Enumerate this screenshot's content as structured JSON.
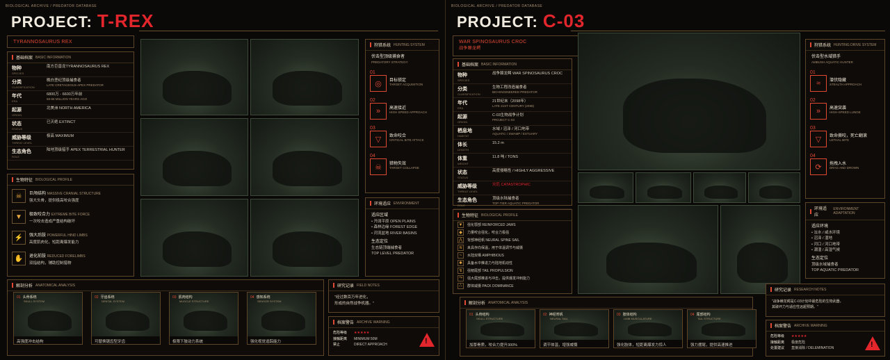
{
  "left": {
    "crumb": "BIOLOGICAL ARCHIVE  /  PREDATOR DATABASE",
    "title_prefix": "PROJECT:",
    "title_code": "T-REX",
    "subtitle": "TYRANNOSAURUS REX",
    "basic": {
      "zh": "基础档案",
      "en": "BASIC INFORMATION",
      "rows": [
        {
          "k": "物种",
          "ken": "SPECIES",
          "v": "南方巨兽龙TYRANNOSAURUS REX",
          "v2": ""
        },
        {
          "k": "分类",
          "ken": "CLASSIFICATION",
          "v": "晚白垩纪顶级捕食者",
          "v2": "LATE CRETACEOUS APEX PREDATOR"
        },
        {
          "k": "年代",
          "ken": "ERA",
          "v": "6800万 - 6600万年前",
          "v2": "68-66 MILLION YEARS AGO"
        },
        {
          "k": "起源",
          "ken": "ORIGIN",
          "v": "北美洲   NORTH AMERICA",
          "v2": ""
        },
        {
          "k": "状态",
          "ken": "STATUS",
          "v": "已灭绝   EXTINCT",
          "v2": ""
        },
        {
          "k": "威胁等级",
          "ken": "THREAT LEVEL",
          "v": "极高   MAXIMUM",
          "v2": ""
        },
        {
          "k": "生态角色",
          "ken": "ROLE",
          "v": "陆地顶级猎手   APEX TERRESTRIAL HUNTER",
          "v2": ""
        }
      ]
    },
    "bio": {
      "zh": "生物特征",
      "en": "BIOLOGICAL PROFILE",
      "items": [
        {
          "icon": "skull-icon",
          "glyph": "☠",
          "zh": "巨颅结构",
          "en": "MASSIVE CRANIAL STRUCTURE",
          "d": "强大头骨，提供极高咬合强度"
        },
        {
          "icon": "jaw-icon",
          "glyph": "▼",
          "zh": "极致咬合力",
          "en": "EXTREME BITE FORCE",
          "d": "一次咬击造成严重结构破坏"
        },
        {
          "icon": "leg-icon",
          "glyph": "⚡",
          "zh": "强大后肢",
          "en": "POWERFUL HIND LIMBS",
          "d": "高度肌肉化，短距离爆发能力"
        },
        {
          "icon": "forelimb-icon",
          "glyph": "✋",
          "zh": "退化前肢",
          "en": "REDUCED FORELIMBS",
          "d": "双指结构，辅助控制猎物"
        }
      ]
    },
    "hunt": {
      "zh": "狩猎系统",
      "en": "HUNTING SYSTEM",
      "strategy": "伏击型顶级捕食者",
      "strategy_en": "PREDATORY STRATEGY",
      "steps": [
        {
          "n": "01",
          "glyph": "◎",
          "icon": "target-icon",
          "zh": "目标锁定",
          "en": "TARGET ACQUISITION"
        },
        {
          "n": "02",
          "glyph": "»",
          "icon": "chevron-icon",
          "zh": "高速接近",
          "en": "HIGH SPEED APPROACH"
        },
        {
          "n": "03",
          "glyph": "▽",
          "icon": "bite-icon",
          "zh": "致命咬合",
          "en": "CRITICAL BITE ATTACK"
        },
        {
          "n": "04",
          "glyph": "☠",
          "icon": "skull-icon",
          "zh": "猎物失效",
          "en": "TARGET COLLAPSE"
        }
      ]
    },
    "env": {
      "zh": "环境适应",
      "en": "ENVIRONMENT",
      "area": "适应区域",
      "areas": [
        "• 开阔平原  OPEN PLAINS",
        "• 森林边缘  FOREST EDGE",
        "• 河流盆地  RIVER BASINS"
      ],
      "eco": "生态定位",
      "eco_v": "生态链顶端捕食者",
      "eco_en": "TOP LEVEL PREDATOR"
    },
    "anat": {
      "zh": "解剖分析",
      "en": "ANATOMICAL ANALYSIS",
      "cards": [
        {
          "n": "01",
          "t": "头骨系统",
          "te": "SKULL SYSTEM",
          "f": "高强度冲击结构"
        },
        {
          "n": "02",
          "t": "牙齿系统",
          "te": "DENTAL SYSTEM",
          "f": "可替换锯齿型牙齿"
        },
        {
          "n": "03",
          "t": "肌肉结构",
          "te": "MUSCLE STRUCTURE",
          "f": "极限下肢动力系统"
        },
        {
          "n": "04",
          "t": "感知系统",
          "te": "SENSOR SYSTEM",
          "f": "强化视觉追踪能力"
        }
      ]
    },
    "notes": {
      "zh": "研究记录",
      "en": "FIELD NOTES",
      "text": "\"经过数百万年进化，\n形成的自然战争机器。\""
    },
    "warn": {
      "zh": "档案警告",
      "en": "ARCHIVE WARNING",
      "rows": [
        [
          "危险等级",
          "★★★★★"
        ],
        [
          "接触距离",
          "MINIMUM 50M"
        ],
        [
          "禁止",
          "DIRECT APPROACH"
        ]
      ]
    }
  },
  "right": {
    "crumb": "BIOLOGICAL ARCHIVE  /  PREDATOR DATABASE",
    "title_prefix": "PROJECT:",
    "title_code": "C-03",
    "subtitle": "WAR SPINOSAURUS CROC",
    "subtitle_zh": "战争棘龙鳄",
    "basic": {
      "zh": "基础档案",
      "en": "BASIC INFORMATION",
      "rows": [
        {
          "k": "物种",
          "ken": "SPECIES",
          "v": "战争棘龙鳄 WAR SPINOSAURUS CROC",
          "v2": ""
        },
        {
          "k": "分类",
          "ken": "CLASSIFICATION",
          "v": "生物工程改造捕食者",
          "v2": "BIO-ENGINEERED PREDATOR"
        },
        {
          "k": "年代",
          "ken": "ERA",
          "v": "21世纪末（2098年）",
          "v2": "LATE 21ST CENTURY (2098)"
        },
        {
          "k": "起源",
          "ken": "ORIGIN",
          "v": "C-03生物战争计划",
          "v2": "PROJECT C-03"
        },
        {
          "k": "栖息地",
          "ken": "HABITAT",
          "v": "水域 / 沼泽 / 河口地带",
          "v2": "AQUATIC / SWAMP / ESTUARY"
        },
        {
          "k": "体长",
          "ken": "LENGTH",
          "v": "15.2 m",
          "v2": ""
        },
        {
          "k": "体重",
          "ken": "WEIGHT",
          "v": "11.8 吨  / TONS",
          "v2": ""
        },
        {
          "k": "状态",
          "ken": "STATUS",
          "v": "高度侵略性 / HIGHLY AGGRESSIVE",
          "v2": ""
        },
        {
          "k": "威胁等级",
          "ken": "THREAT LEVEL",
          "v": "灾厄   CATASTROPHIC",
          "v2": "",
          "red": true
        },
        {
          "k": "生态角色",
          "ken": "ROLE",
          "v": "顶级水陆捕食者",
          "v2": "TOP-TIER AQUATIC PREDATOR"
        }
      ]
    },
    "bio": {
      "zh": "生物特征",
      "en": "BIOLOGICAL PROFILE",
      "items": [
        {
          "icon": "jaw-icon",
          "glyph": "▼",
          "d": "强化颚部 REINFORCED JAWS"
        },
        {
          "icon": "muscle-icon",
          "glyph": "◆",
          "d": "力量咬合强化，咬合力极强"
        },
        {
          "icon": "spine-icon",
          "glyph": "⋀",
          "d": "背部神经帆 NEURAL SPINE SAIL"
        },
        {
          "icon": "sail-icon",
          "glyph": "≋",
          "d": "来具存向保温，用于体温调节与威慑"
        },
        {
          "icon": "amphibious-icon",
          "glyph": "~",
          "d": "水陆双栖 AMPHIBIOUS"
        },
        {
          "icon": "tail-icon",
          "glyph": "✱",
          "d": "具备水中推进力与陆地机动性"
        },
        {
          "icon": "propulsion-icon",
          "glyph": "↯",
          "d": "强韧尾部 TAIL PROPULSION"
        },
        {
          "icon": "tail2-icon",
          "glyph": "⤳",
          "d": "强大尾部推进与冲击，提供爆发冲刺能力"
        },
        {
          "icon": "pack-icon",
          "glyph": "⛬",
          "d": "群体威慑 PACK DOMINANCE"
        }
      ]
    },
    "hunt": {
      "zh": "狩猎系统",
      "en": "HUNTING DRIVE SYSTEM",
      "strategy": "伏击型水域猎手",
      "strategy_en": "AMBUSH AQUATIC HUNTER",
      "steps": [
        {
          "n": "01",
          "glyph": "≈",
          "icon": "wave-icon",
          "zh": "潜伏隐藏",
          "en": "STEALTH APPROACH"
        },
        {
          "n": "02",
          "glyph": "»",
          "icon": "chevron-icon",
          "zh": "高速突袭",
          "en": "HIGH-SPEED LUNGE"
        },
        {
          "n": "03",
          "glyph": "▽",
          "icon": "bite-icon",
          "zh": "致命撕咬，死亡翻滚",
          "en": "LETHAL BITE"
        },
        {
          "n": "04",
          "glyph": "⟳",
          "icon": "drag-icon",
          "zh": "拖拽入水",
          "en": "DRAG AND DROWN"
        }
      ]
    },
    "env": {
      "zh": "环境适应",
      "en": "ENVIRONMENT ADAPTATION",
      "area": "适应环境",
      "areas": [
        "• 淡水 / 咸水环境",
        "• 沼泽 / 湿地",
        "• 河口 / 河口地带",
        "• 潮湿 / 高湿气候"
      ],
      "eco": "生态定位",
      "eco_v": "顶级水域捕食者",
      "eco_en": "TOP AQUATIC PREDATOR"
    },
    "anat": {
      "zh": "解剖分析",
      "en": "ANATOMICAL ANALYSIS",
      "cards": [
        {
          "n": "01",
          "t": "头骨结构",
          "te": "SKULL STRUCTURE",
          "f": "加厚骨质，咬合力提升300%"
        },
        {
          "n": "02",
          "t": "神经脊帆",
          "te": "NEURAL SAIL",
          "f": "调节体温，增强威慑"
        },
        {
          "n": "03",
          "t": "肢体结构",
          "te": "LIMB MUSCULATURE",
          "f": "强化肢体，短距离爆发力惊人"
        },
        {
          "n": "04",
          "t": "尾部结构",
          "te": "TAIL STRUCTURE",
          "f": "强力摆尾，提供高速推进"
        }
      ]
    },
    "notes": {
      "zh": "研究记录",
      "en": "RESEARCH NOTES",
      "text": "\"战争棘龙鳄是C-03计划中最危险的生物武器，\n其破坏力与适应性远超预期。\""
    },
    "warn": {
      "zh": "档案警告",
      "en": "ARCHIVE WARNING",
      "rows": [
        [
          "危险等级",
          "★★★★★"
        ],
        [
          "接触距离",
          "极度危险"
        ],
        [
          "处置建议",
          "直接消除 / DELEMINATION"
        ]
      ]
    }
  }
}
